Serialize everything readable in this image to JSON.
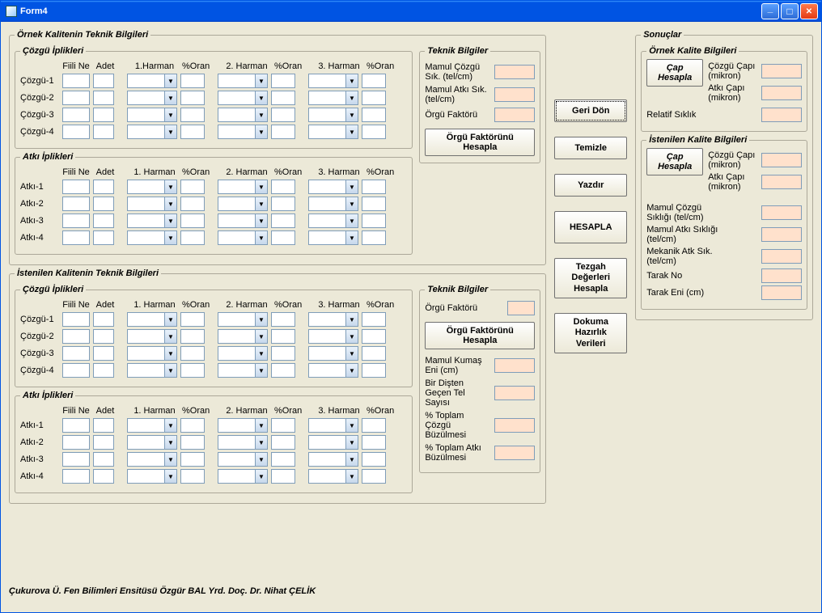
{
  "window": {
    "title": "Form4"
  },
  "groups": {
    "ornek_teknik": "Örnek Kalitenin Teknik Bilgileri",
    "cozgu_iplik": "Çözgü İplikleri",
    "atki_iplik": "Atkı İplikleri",
    "istenilen_teknik": "İstenilen Kalitenin Teknik Bilgileri",
    "teknik_bilgiler": "Teknik Bilgiler",
    "sonuclar": "Sonuçlar",
    "ornek_kalite_bilgileri": "Örnek Kalite Bilgileri",
    "istenilen_kalite_bilgileri": "İstenilen Kalite Bilgileri"
  },
  "columns": {
    "fiiline": "Fiili Ne",
    "adet": "Adet",
    "harman1": "1.Harman",
    "harman1b": "1. Harman",
    "harman2": "2. Harman",
    "harman3": "3. Harman",
    "oran": "%Oran"
  },
  "rows": {
    "cozgu": [
      "Çözgü-1",
      "Çözgü-2",
      "Çözgü-3",
      "Çözgü-4"
    ],
    "atki": [
      "Atkı-1",
      "Atkı-2",
      "Atkı-3",
      "Atkı-4"
    ]
  },
  "teknik_upper": {
    "mamul_cozgu_sik": "Mamul Çözgü Sık. (tel/cm)",
    "mamul_atki_sik": "Mamul Atkı Sık. (tel/cm)",
    "orgu_faktoru": "Örgü Faktörü",
    "orgu_faktorunu_hesapla": "Örgü Faktörünü Hesapla"
  },
  "teknik_lower": {
    "orgu_faktoru": "Örgü Faktörü",
    "orgu_faktorunu_hesapla": "Örgü Faktörünü Hesapla",
    "mamul_kumas_eni": "Mamul Kumaş Eni (cm)",
    "bir_disten": "Bir Dişten Geçen Tel Sayısı",
    "toplam_cozgu_buz": "% Toplam Çözgü Büzülmesi",
    "toplam_atki_buz": "% Toplam Atkı Büzülmesi"
  },
  "buttons": {
    "geri_don": "Geri Dön",
    "temizle": "Temizle",
    "yazdir": "Yazdır",
    "hesapla": "HESAPLA",
    "tezgah": "Tezgah\nDeğerleri\nHesapla",
    "dokuma": "Dokuma\nHazırlık\nVerileri",
    "cap_hesapla": "Çap\nHesapla"
  },
  "sonuc_labels": {
    "cozgu_capi": "Çözgü Çapı (mikron)",
    "atki_capi": "Atkı Çapı (mikron)",
    "relatif_siklik": "Relatif Sıklık",
    "mamul_cozgu_sikligi": "Mamul Çözgü Sıklığı (tel/cm)",
    "mamul_atki_sikligi": "Mamul Atkı Sıklığı (tel/cm)",
    "mekanik_atk_sik": "Mekanik Atk Sık. (tel/cm)",
    "tarak_no": "Tarak No",
    "tarak_eni": "Tarak Eni (cm)"
  },
  "footer": "Çukurova Ü. Fen Bilimleri Ensitüsü    Özgür BAL    Yrd. Doç. Dr. Nihat ÇELİK"
}
